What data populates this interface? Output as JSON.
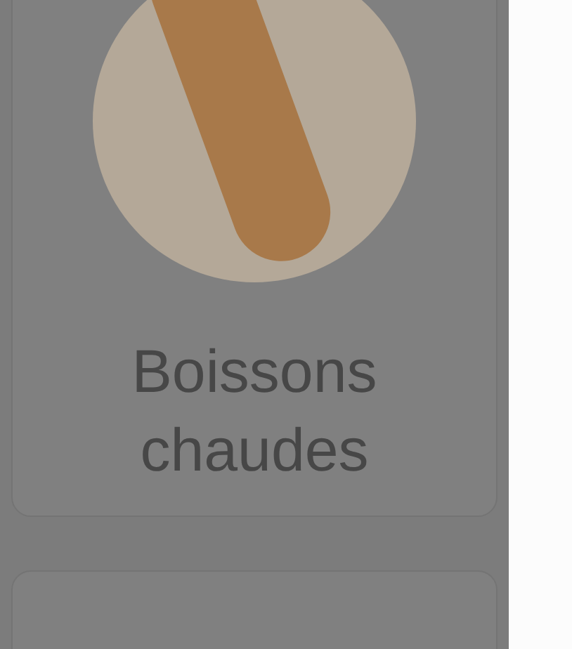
{
  "category_cards": [
    {
      "title": "Boissons chaudes"
    }
  ]
}
